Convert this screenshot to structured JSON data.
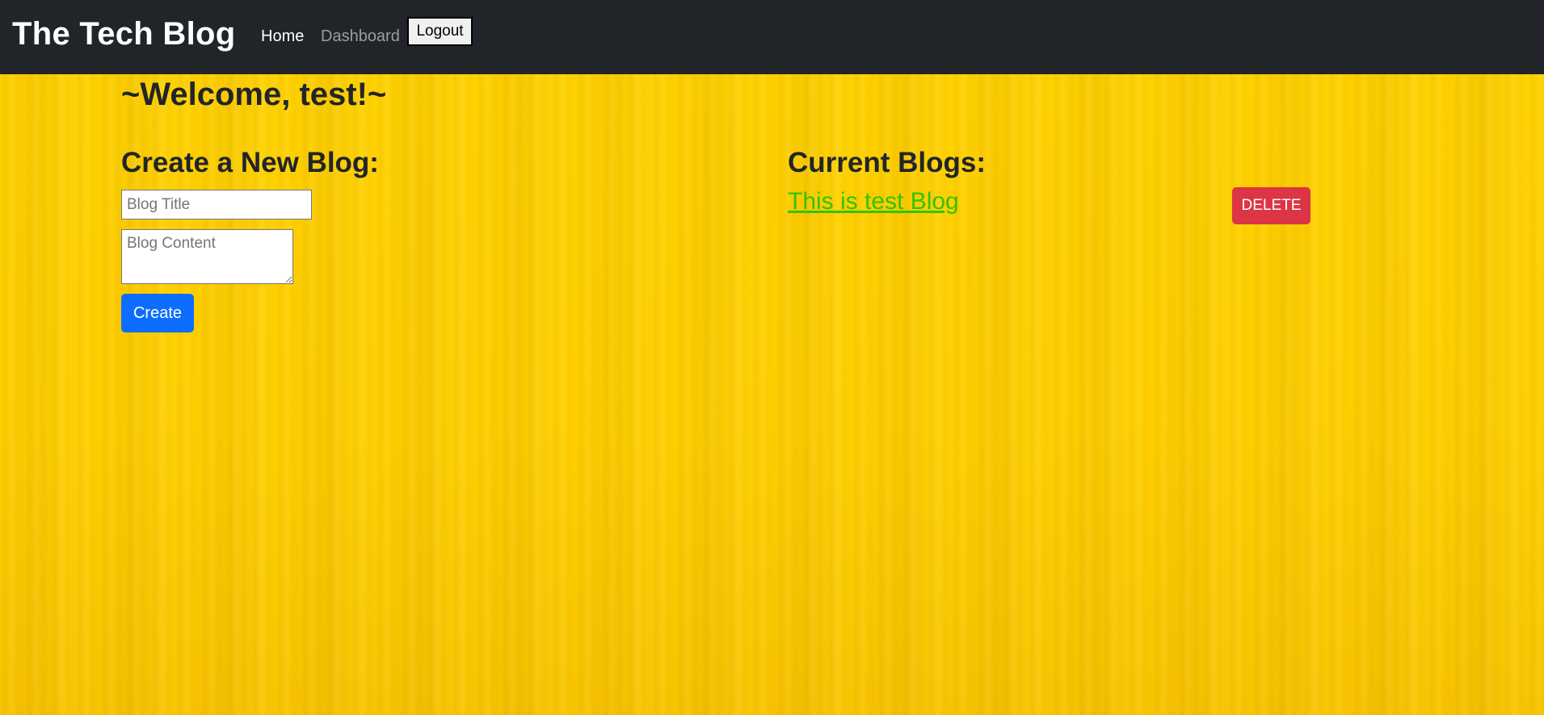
{
  "navbar": {
    "brand": "The Tech Blog",
    "links": [
      {
        "label": "Home",
        "active": true
      },
      {
        "label": "Dashboard",
        "active": false
      }
    ],
    "logout_label": "Logout"
  },
  "welcome": "~Welcome, test!~",
  "create_section": {
    "title": "Create a New Blog:",
    "title_placeholder": "Blog Title",
    "title_value": "",
    "content_placeholder": "Blog Content",
    "content_value": "",
    "create_label": "Create"
  },
  "current_section": {
    "title": "Current Blogs:",
    "blogs": [
      {
        "title": "This is test Blog",
        "delete_label": "DELETE"
      }
    ]
  },
  "colors": {
    "navbar_bg": "#212529",
    "page_bg": "#ffcf00",
    "create_button": "#0d6efd",
    "delete_button": "#dc3545",
    "blog_link": "#2fc500"
  }
}
